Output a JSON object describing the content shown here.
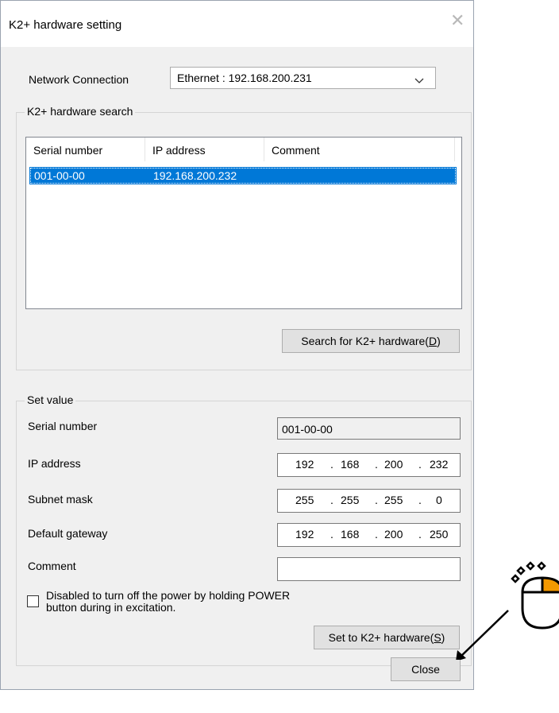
{
  "window": {
    "title": "K2+ hardware setting"
  },
  "network": {
    "label": "Network Connection",
    "value": "Ethernet : 192.168.200.231"
  },
  "search_group": {
    "title": "K2+ hardware search",
    "columns": [
      "Serial number",
      "IP address",
      "Comment"
    ],
    "rows": [
      {
        "serial": "001-00-00",
        "ip": "192.168.200.232",
        "comment": ""
      }
    ],
    "search_button": {
      "text": "Search for K2+ hardware(",
      "key": "D",
      "close": ")"
    }
  },
  "set_group": {
    "title": "Set value",
    "serial": {
      "label": "Serial number",
      "value": "001-00-00"
    },
    "ip": {
      "label": "IP address",
      "octets": [
        "192",
        "168",
        "200",
        "232"
      ]
    },
    "subnet": {
      "label": "Subnet mask",
      "octets": [
        "255",
        "255",
        "255",
        "0"
      ]
    },
    "gateway": {
      "label": "Default gateway",
      "octets": [
        "192",
        "168",
        "200",
        "250"
      ]
    },
    "comment": {
      "label": "Comment",
      "value": ""
    },
    "checkbox": {
      "line1": "Disabled to turn off the power by holding POWER",
      "line2": "button during in excitation."
    },
    "set_button": {
      "text": "Set to K2+ hardware(",
      "key": "S",
      "close": ")"
    }
  },
  "close_button": {
    "label": "Close"
  },
  "colors": {
    "selection": "#0078d7",
    "mouse_highlight": "#f39800"
  },
  "icons": {
    "mouse": "mouse-click-icon",
    "arrow": "pointer-arrow"
  }
}
